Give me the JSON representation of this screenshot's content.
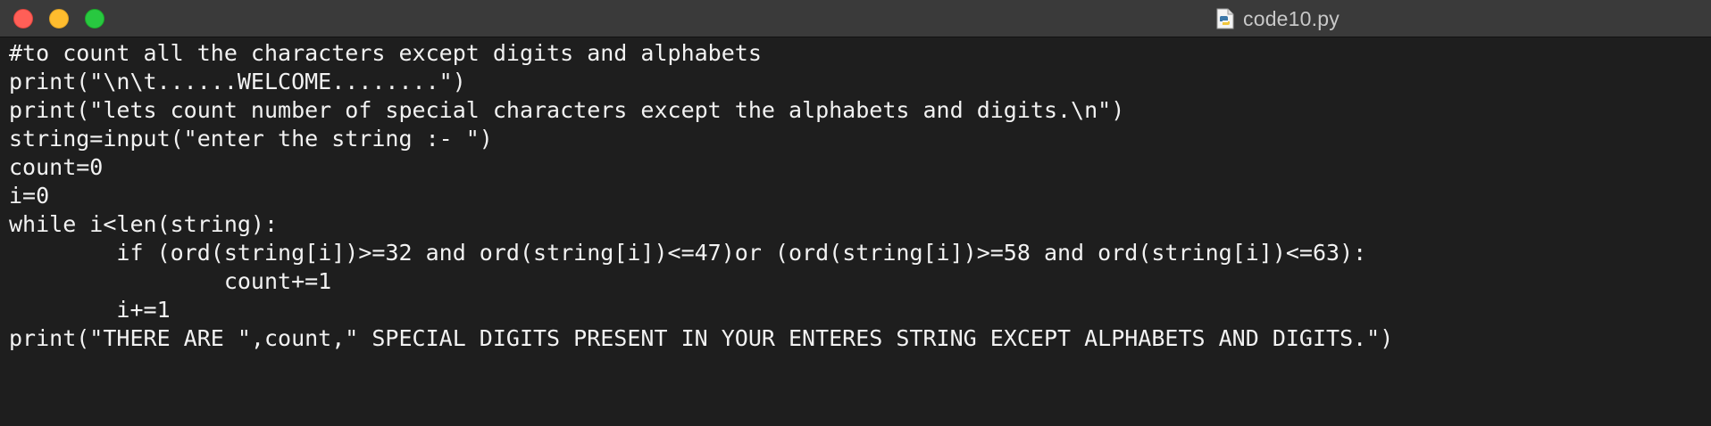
{
  "window": {
    "title": "code10.py",
    "file_icon": "python-file-icon",
    "traffic_lights": {
      "close_color": "#ff5f57",
      "minimize_color": "#febc2e",
      "zoom_color": "#28c840"
    }
  },
  "editor": {
    "background": "#1e1e1e",
    "text_color": "#f2f2f2",
    "lines": [
      "#to count all the characters except digits and alphabets",
      "print(\"\\n\\t......WELCOME........\")",
      "print(\"lets count number of special characters except the alphabets and digits.\\n\")",
      "string=input(\"enter the string :- \")",
      "count=0",
      "i=0",
      "while i<len(string):",
      "\tif (ord(string[i])>=32 and ord(string[i])<=47)or (ord(string[i])>=58 and ord(string[i])<=63):",
      "\t\tcount+=1",
      "\ti+=1",
      "print(\"THERE ARE \",count,\" SPECIAL DIGITS PRESENT IN YOUR ENTERES STRING EXCEPT ALPHABETS AND DIGITS.\")"
    ]
  }
}
